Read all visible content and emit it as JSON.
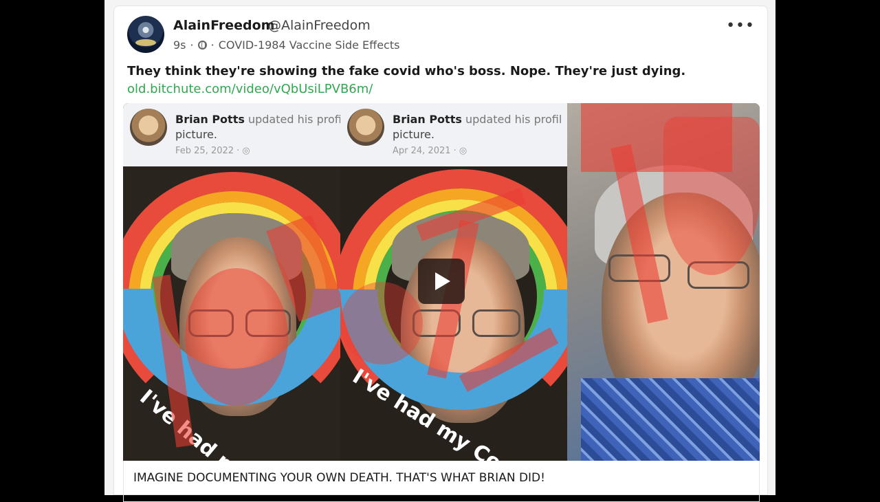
{
  "post": {
    "author_name": "AlainFreedom",
    "author_handle": "@AlainFreedom",
    "timestamp": "9s",
    "separator": "·",
    "group": "COVID-1984 Vaccine Side Effects",
    "more_label": "•••",
    "text": "They think they're showing the fake covid who's boss. Nope. They're just dying.",
    "link": "old.bitchute.com/video/vQbUsiLPVB6m/",
    "caption": "IMAGINE DOCUMENTING YOUR OWN DEATH.  THAT'S WHAT BRIAN DID!"
  },
  "thumbnail": {
    "panels": [
      {
        "name": "Brian Potts",
        "action": "updated his profi",
        "sub": "picture.",
        "date": "Feb 25, 2022 · ◎",
        "band_text": "I've had my"
      },
      {
        "name": "Brian Potts",
        "action": "updated his profil",
        "sub": "picture.",
        "date": "Apr 24, 2021 · ◎",
        "band_text": "I've had my Covid"
      }
    ],
    "overlay_color": "#eb3c32",
    "play_icon": "play-icon"
  }
}
